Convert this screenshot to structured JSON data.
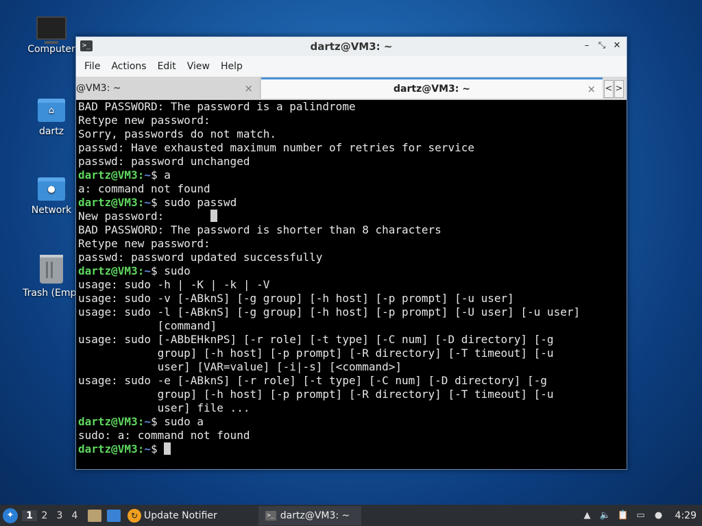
{
  "desktop": {
    "icons": [
      {
        "label": "Computer",
        "icon": "computer-icon"
      },
      {
        "label": "dartz",
        "icon": "home-folder-icon"
      },
      {
        "label": "Network",
        "icon": "network-folder-icon"
      },
      {
        "label": "Trash (Empt",
        "icon": "trash-icon"
      }
    ]
  },
  "window": {
    "title": "dartz@VM3: ~",
    "menu": [
      "File",
      "Actions",
      "Edit",
      "View",
      "Help"
    ],
    "tabs": [
      {
        "label": "@VM3: ~",
        "active": false
      },
      {
        "label": "dartz@VM3: ~",
        "active": true
      }
    ],
    "tab_close": "×",
    "scroll_left": "<",
    "scroll_right": ">",
    "wm_buttons": {
      "minimize": "–",
      "maximize": "⤡",
      "close": "✕"
    }
  },
  "terminal": {
    "prompt_user": "dartz@VM3",
    "prompt_sep": ":",
    "prompt_path": "~",
    "prompt_end": "$ ",
    "lines": [
      {
        "type": "out",
        "text": "BAD PASSWORD: The password is a palindrome"
      },
      {
        "type": "out",
        "text": "Retype new password:"
      },
      {
        "type": "out",
        "text": "Sorry, passwords do not match."
      },
      {
        "type": "out",
        "text": "passwd: Have exhausted maximum number of retries for service"
      },
      {
        "type": "out",
        "text": "passwd: password unchanged"
      },
      {
        "type": "cmd",
        "text": "a"
      },
      {
        "type": "out",
        "text": "a: command not found"
      },
      {
        "type": "cmd",
        "text": "sudo passwd"
      },
      {
        "type": "out",
        "text": "New password:       "
      },
      {
        "type": "out",
        "text": "BAD PASSWORD: The password is shorter than 8 characters"
      },
      {
        "type": "out",
        "text": "Retype new password:"
      },
      {
        "type": "out",
        "text": "passwd: password updated successfully"
      },
      {
        "type": "cmd",
        "text": "sudo"
      },
      {
        "type": "out",
        "text": "usage: sudo -h | -K | -k | -V"
      },
      {
        "type": "out",
        "text": "usage: sudo -v [-ABknS] [-g group] [-h host] [-p prompt] [-u user]"
      },
      {
        "type": "out",
        "text": "usage: sudo -l [-ABknS] [-g group] [-h host] [-p prompt] [-U user] [-u user]"
      },
      {
        "type": "out",
        "text": "            [command]"
      },
      {
        "type": "out",
        "text": "usage: sudo [-ABbEHknPS] [-r role] [-t type] [-C num] [-D directory] [-g"
      },
      {
        "type": "out",
        "text": "            group] [-h host] [-p prompt] [-R directory] [-T timeout] [-u"
      },
      {
        "type": "out",
        "text": "            user] [VAR=value] [-i|-s] [<command>]"
      },
      {
        "type": "out",
        "text": "usage: sudo -e [-ABknS] [-r role] [-t type] [-C num] [-D directory] [-g"
      },
      {
        "type": "out",
        "text": "            group] [-h host] [-p prompt] [-R directory] [-T timeout] [-u"
      },
      {
        "type": "out",
        "text": "            user] file ..."
      },
      {
        "type": "cmd",
        "text": "sudo a"
      },
      {
        "type": "out",
        "text": "sudo: a: command not found"
      },
      {
        "type": "cmd",
        "text": "",
        "cursor": true
      }
    ]
  },
  "taskbar": {
    "workspaces": [
      "1",
      "2",
      "3",
      "4"
    ],
    "active_workspace": "1",
    "update_notifier": "Update Notifier",
    "task_label": "dartz@VM3: ~",
    "tray_icons": [
      "arrow-up-icon",
      "volume-icon",
      "clipboard-icon",
      "network-icon",
      "notification-icon"
    ],
    "clock": "4:29"
  }
}
